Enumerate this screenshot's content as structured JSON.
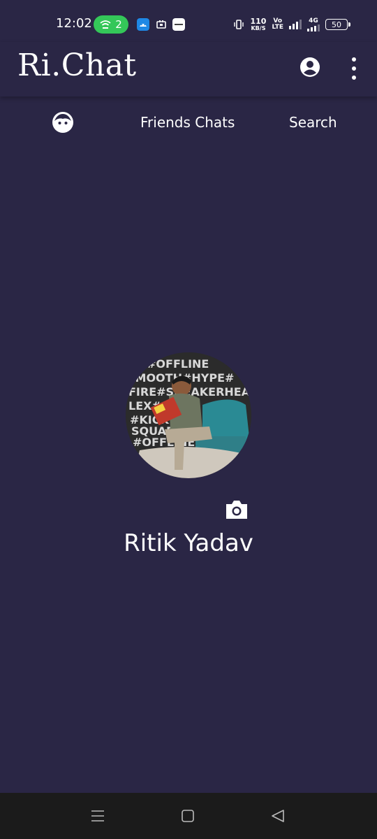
{
  "status_bar": {
    "time": "12:02",
    "hotspot_count": "2",
    "net_speed_value": "110",
    "net_speed_unit": "KB/S",
    "volte_line1": "Vo",
    "volte_line2": "LTE",
    "network_type": "4G",
    "battery": "50"
  },
  "app_bar": {
    "title": "Ri.Chat",
    "profile_icon": "account-circle-icon",
    "menu_icon": "more-vert-icon"
  },
  "tabs": [
    {
      "icon": "face-icon",
      "label": ""
    },
    {
      "label": "Friends Chats"
    },
    {
      "label": "Search"
    }
  ],
  "profile": {
    "name": "Ritik Yadav",
    "camera_icon": "camera-icon",
    "avatar_wall_text": [
      "#OFFLINE",
      "SMOOTH#HYPE#",
      "FIRE#SNEAKERHEAD",
      "LEX#SAM",
      "#KICK",
      "SQUAD",
      "#OFFLINE"
    ]
  },
  "nav_bar": {
    "recents_icon": "menu-lines-icon",
    "home_icon": "square-icon",
    "back_icon": "triangle-back-icon"
  },
  "colors": {
    "background": "#2a2645",
    "hotspot": "#34c759",
    "nav_bar": "#1b1b1b"
  }
}
